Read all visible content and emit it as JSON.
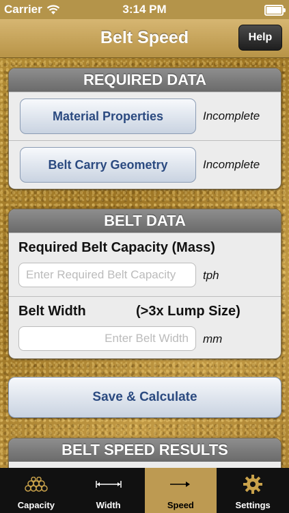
{
  "status_bar": {
    "carrier": "Carrier",
    "time": "3:14 PM"
  },
  "nav": {
    "title": "Belt Speed",
    "help_label": "Help"
  },
  "required_data": {
    "header": "REQUIRED DATA",
    "items": [
      {
        "label": "Material Properties",
        "status": "Incomplete"
      },
      {
        "label": "Belt Carry Geometry",
        "status": "Incomplete"
      }
    ]
  },
  "belt_data": {
    "header": "BELT DATA",
    "capacity": {
      "label": "Required Belt Capacity (Mass)",
      "placeholder": "Enter Required Belt Capacity",
      "unit": "tph"
    },
    "width": {
      "label": "Belt Width",
      "hint": "(>3x Lump Size)",
      "placeholder": "Enter Belt Width",
      "unit": "mm"
    }
  },
  "actions": {
    "calculate_label": "Save & Calculate"
  },
  "results": {
    "header": "BELT SPEED RESULTS"
  },
  "tabs": [
    {
      "label": "Capacity",
      "icon": "stacked-pipes-icon",
      "active": false
    },
    {
      "label": "Width",
      "icon": "width-arrows-icon",
      "active": false
    },
    {
      "label": "Speed",
      "icon": "right-arrow-icon",
      "active": true
    },
    {
      "label": "Settings",
      "icon": "gear-icon",
      "active": false
    }
  ],
  "colors": {
    "accent_gold": "#bd9a52",
    "button_text": "#2b4a80",
    "tab_bar": "#111111"
  }
}
